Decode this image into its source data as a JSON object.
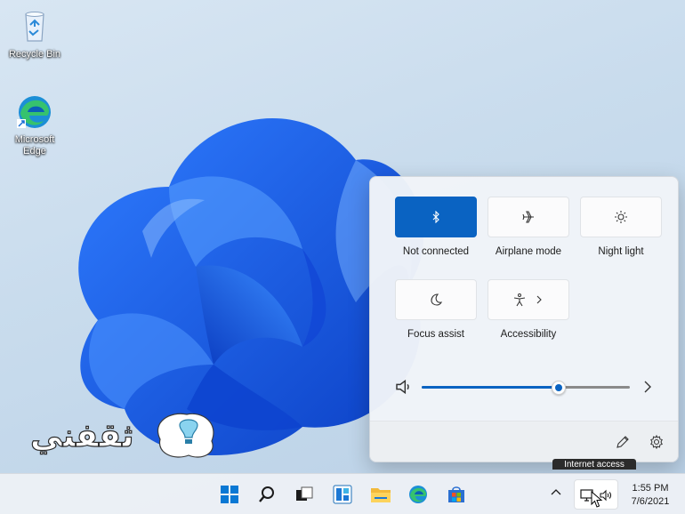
{
  "desktop": {
    "icons": [
      {
        "label": "Recycle Bin",
        "icon": "recycle-bin-icon"
      },
      {
        "label": "Microsoft Edge",
        "icon": "edge-icon"
      }
    ],
    "watermark_text": "ثقفني"
  },
  "quick_settings": {
    "tiles": [
      {
        "label": "Not connected",
        "icon": "bluetooth-icon",
        "active": true
      },
      {
        "label": "Airplane mode",
        "icon": "airplane-icon",
        "active": false
      },
      {
        "label": "Night light",
        "icon": "brightness-icon",
        "active": false
      },
      {
        "label": "Focus assist",
        "icon": "moon-icon",
        "active": false
      },
      {
        "label": "Accessibility",
        "icon": "accessibility-icon",
        "active": false,
        "has_chevron": true
      }
    ],
    "volume": {
      "percent": 66,
      "icon": "speaker-icon"
    },
    "footer": {
      "edit_icon": "pencil-icon",
      "settings_icon": "gear-icon"
    }
  },
  "tooltip": {
    "text": "Internet access"
  },
  "taskbar": {
    "apps": [
      "start-icon",
      "search-icon",
      "task-view-icon",
      "widgets-icon",
      "file-explorer-icon",
      "edge-icon",
      "store-icon"
    ],
    "tray": {
      "chevron": "chevron-up-icon",
      "network": "network-icon",
      "volume": "speaker-icon"
    },
    "clock": {
      "time": "1:55 PM",
      "date": "7/6/2021"
    }
  },
  "colors": {
    "accent": "#0a63c2",
    "bloom": "#1a5cf0"
  }
}
